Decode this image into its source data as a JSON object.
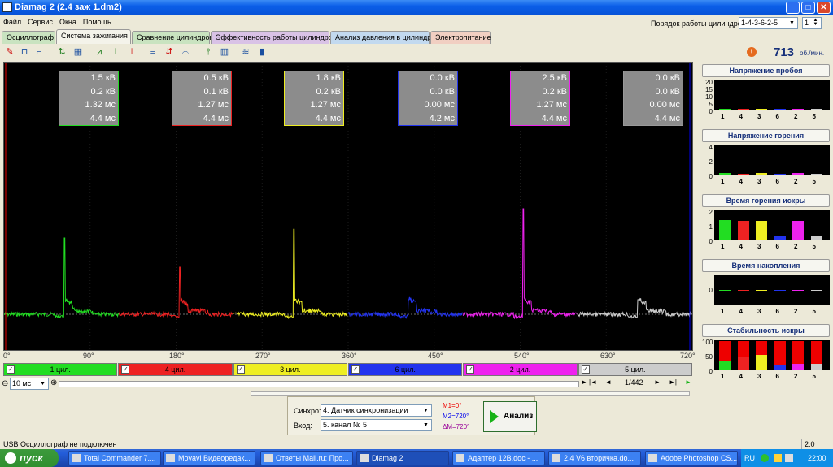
{
  "window": {
    "title": "Diamag 2 (2.4 заж 1.dm2)"
  },
  "menu": [
    "Файл",
    "Сервис",
    "Окна",
    "Помощь"
  ],
  "cylinder_order": {
    "label": "Порядок работы цилиндров",
    "value": "1-4-3-6-2-5",
    "count": "1"
  },
  "tabs": [
    {
      "label": "Осциллограф",
      "color": "#c9e3c0"
    },
    {
      "label": "Система зажигания",
      "color": "#f4f3ea",
      "active": true
    },
    {
      "label": "Сравнение цилиндров",
      "color": "#c9e3c0"
    },
    {
      "label": "Эффективность работы цилиндров",
      "color": "#d9c2e6"
    },
    {
      "label": "Анализ давления в цилиндре",
      "color": "#c2d9ef"
    },
    {
      "label": "Электропитание",
      "color": "#f1cfc2"
    }
  ],
  "rpm": {
    "value": "713",
    "unit": "об./мин."
  },
  "value_boxes": [
    {
      "lines": [
        "1.5 кВ",
        "0.2 кВ",
        "1.32 мс",
        "4.4 мс"
      ],
      "color": "#22dd22"
    },
    {
      "lines": [
        "0.5 кВ",
        "0.1 кВ",
        "1.27 мс",
        "4.4 мс"
      ],
      "color": "#ee2222"
    },
    {
      "lines": [
        "1.8 кВ",
        "0.2 кВ",
        "1.27 мс",
        "4.4 мс"
      ],
      "color": "#eeee22"
    },
    {
      "lines": [
        "0.0 кВ",
        "0.0 кВ",
        "0.00 мс",
        "4.2 мс"
      ],
      "color": "#2233ee"
    },
    {
      "lines": [
        "2.5 кВ",
        "0.2 кВ",
        "1.27 мс",
        "4.4 мс"
      ],
      "color": "#ee22ee"
    },
    {
      "lines": [
        "0.0 кВ",
        "0.0 кВ",
        "0.00 мс",
        "4.4 мс"
      ],
      "color": "#999999"
    }
  ],
  "axis_labels": [
    "0°",
    "90°",
    "180°",
    "270°",
    "360°",
    "450°",
    "540°",
    "630°",
    "720°"
  ],
  "cylinders": [
    {
      "label": "1 цил.",
      "color": "#22dd22"
    },
    {
      "label": "4 цил.",
      "color": "#ee2222"
    },
    {
      "label": "3 цил.",
      "color": "#eeee22"
    },
    {
      "label": "6 цил.",
      "color": "#2233ee"
    },
    {
      "label": "2 цил.",
      "color": "#ee22ee"
    },
    {
      "label": "5 цил.",
      "color": "#cccccc"
    }
  ],
  "nav": {
    "timebase": "10 мс",
    "page": "1/442"
  },
  "controls": {
    "sync_label": "Синхро:",
    "sync_value": "4. Датчик синхронизации",
    "input_label": "Вход:",
    "input_value": "5. канал № 5",
    "m1": "M1=0°",
    "m2": "M2=720°",
    "dm": "ΔM=720°",
    "analyze": "Анализ"
  },
  "panels": [
    {
      "title": "Напряжение пробоя",
      "yticks": [
        "20",
        "15",
        "10",
        "5",
        "0"
      ],
      "values": [
        0.05,
        0.02,
        0.05,
        0.0,
        0.1,
        0.0
      ],
      "ymax": 20
    },
    {
      "title": "Напряжение горения",
      "yticks": [
        "4",
        "2",
        "0"
      ],
      "values": [
        0.2,
        0.1,
        0.2,
        0.0,
        0.2,
        0.0
      ],
      "ymax": 4
    },
    {
      "title": "Время горения искры",
      "yticks": [
        "2",
        "1",
        "0"
      ],
      "values": [
        1.32,
        1.27,
        1.27,
        0.3,
        1.27,
        0.3
      ],
      "ymax": 2
    },
    {
      "title": "Время накопления",
      "yticks": [
        "0"
      ],
      "values": [
        0,
        0,
        0,
        0,
        0,
        0
      ],
      "ymax": 1
    },
    {
      "title": "Стабильность искры",
      "yticks": [
        "100",
        "50",
        "0"
      ],
      "values": [
        30,
        45,
        50,
        15,
        20,
        20
      ],
      "ymax": 100
    }
  ],
  "xcyl": [
    "1",
    "4",
    "3",
    "6",
    "2",
    "5"
  ],
  "status": {
    "text": "USB Осциллограф не подключен",
    "version": "2.0"
  },
  "taskbar": {
    "start": "пуск",
    "tasks": [
      "Total Commander 7....",
      "Movavi Видеоредак...",
      "Ответы Mail.ru: Про...",
      "Diamag 2",
      "Адаптер 12В.doc - ...",
      "2.4 V6 вторичка.do...",
      "Adobe Photoshop CS..."
    ],
    "lang": "RU",
    "clock": "22:00"
  },
  "chart_data": {
    "type": "line",
    "title": "",
    "xlabel": "",
    "ylabel": "",
    "x_ticks": [
      "0°",
      "90°",
      "180°",
      "270°",
      "360°",
      "450°",
      "540°",
      "630°",
      "720°"
    ],
    "xlim": [
      0,
      720
    ],
    "series": [
      {
        "name": "1 цил.",
        "x_start": 0,
        "x_end": 120,
        "spike_at": 63,
        "color": "#22dd22"
      },
      {
        "name": "4 цил.",
        "x_start": 120,
        "x_end": 240,
        "spike_at": 183,
        "color": "#ee2222"
      },
      {
        "name": "3 цил.",
        "x_start": 240,
        "x_end": 360,
        "spike_at": 303,
        "color": "#eeee22"
      },
      {
        "name": "6 цил.",
        "x_start": 360,
        "x_end": 480,
        "spike_at": 423,
        "color": "#2233ee"
      },
      {
        "name": "2 цил.",
        "x_start": 480,
        "x_end": 600,
        "spike_at": 543,
        "color": "#ee22ee"
      },
      {
        "name": "5 цил.",
        "x_start": 600,
        "x_end": 720,
        "spike_at": 663,
        "color": "#cccccc"
      }
    ],
    "spike_heights_kv": [
      1.5,
      0.5,
      1.8,
      0.0,
      2.5,
      0.0
    ],
    "grid": true
  }
}
